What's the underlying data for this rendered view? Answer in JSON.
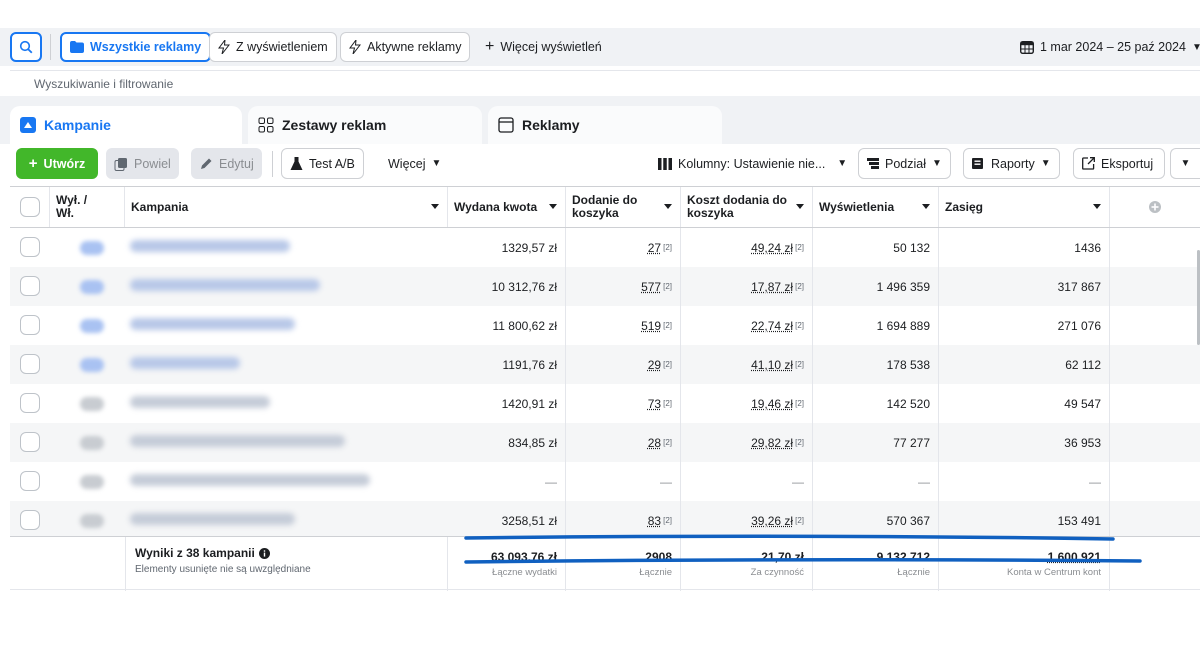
{
  "topbar": {
    "all_ads": "Wszystkie reklamy",
    "with_impressions": "Z wyświetleniem",
    "active_ads": "Aktywne reklamy",
    "more_views": "Więcej wyświetleń",
    "date_range": "1 mar 2024 – 25 paź 2024"
  },
  "filter": {
    "placeholder": "Wyszukiwanie i filtrowanie"
  },
  "tabs": [
    {
      "label": "Kampanie"
    },
    {
      "label": "Zestawy reklam"
    },
    {
      "label": "Reklamy"
    }
  ],
  "toolbar": {
    "create": "Utwórz",
    "duplicate": "Powiel",
    "edit": "Edytuj",
    "ab_test": "Test A/B",
    "more": "Więcej",
    "columns": "Kolumny: Ustawienie nie...",
    "breakdown": "Podział",
    "reports": "Raporty",
    "export": "Eksportuj"
  },
  "columns": {
    "onoff": "Wył. / Wł.",
    "campaign": "Kampania",
    "spent": "Wydana kwota",
    "add_to_cart": "Dodanie do koszyka",
    "cost_add": "Koszt dodania do koszyka",
    "impressions": "Wyświetlenia",
    "reach": "Zasięg"
  },
  "rows": [
    {
      "spent": "1329,57 zł",
      "atc": "27",
      "atc_note": "[2]",
      "cost": "49,24 zł",
      "cost_note": "[2]",
      "impr": "50 132",
      "reach": "1436"
    },
    {
      "spent": "10 312,76 zł",
      "atc": "577",
      "atc_note": "[2]",
      "cost": "17,87 zł",
      "cost_note": "[2]",
      "impr": "1 496 359",
      "reach": "317 867"
    },
    {
      "spent": "11 800,62 zł",
      "atc": "519",
      "atc_note": "[2]",
      "cost": "22,74 zł",
      "cost_note": "[2]",
      "impr": "1 694 889",
      "reach": "271 076"
    },
    {
      "spent": "1191,76 zł",
      "atc": "29",
      "atc_note": "[2]",
      "cost": "41,10 zł",
      "cost_note": "[2]",
      "impr": "178 538",
      "reach": "62 112"
    },
    {
      "spent": "1420,91 zł",
      "atc": "73",
      "atc_note": "[2]",
      "cost": "19,46 zł",
      "cost_note": "[2]",
      "impr": "142 520",
      "reach": "49 547"
    },
    {
      "spent": "834,85 zł",
      "atc": "28",
      "atc_note": "[2]",
      "cost": "29,82 zł",
      "cost_note": "[2]",
      "impr": "77 277",
      "reach": "36 953"
    },
    {
      "spent": "—",
      "atc": "—",
      "atc_note": "",
      "cost": "—",
      "cost_note": "",
      "impr": "—",
      "reach": "—"
    },
    {
      "spent": "3258,51 zł",
      "atc": "83",
      "atc_note": "[2]",
      "cost": "39,26 zł",
      "cost_note": "[2]",
      "impr": "570 367",
      "reach": "153 491"
    }
  ],
  "totals": {
    "title": "Wyniki z 38 kampanii",
    "note": "Elementy usunięte nie są uwzględniane",
    "spent": "63 093,76 zł",
    "spent_sub": "Łączne wydatki",
    "atc": "2908",
    "atc_sub": "Łącznie",
    "cost": "21,70 zł",
    "cost_sub": "Za czynność",
    "impr": "9 132 712",
    "impr_sub": "Łącznie",
    "reach": "1 600 921",
    "reach_sub": "Konta w Centrum kont"
  },
  "colors": {
    "accent": "#1877f2",
    "create": "#42b72a",
    "annotation": "#1060c0"
  }
}
